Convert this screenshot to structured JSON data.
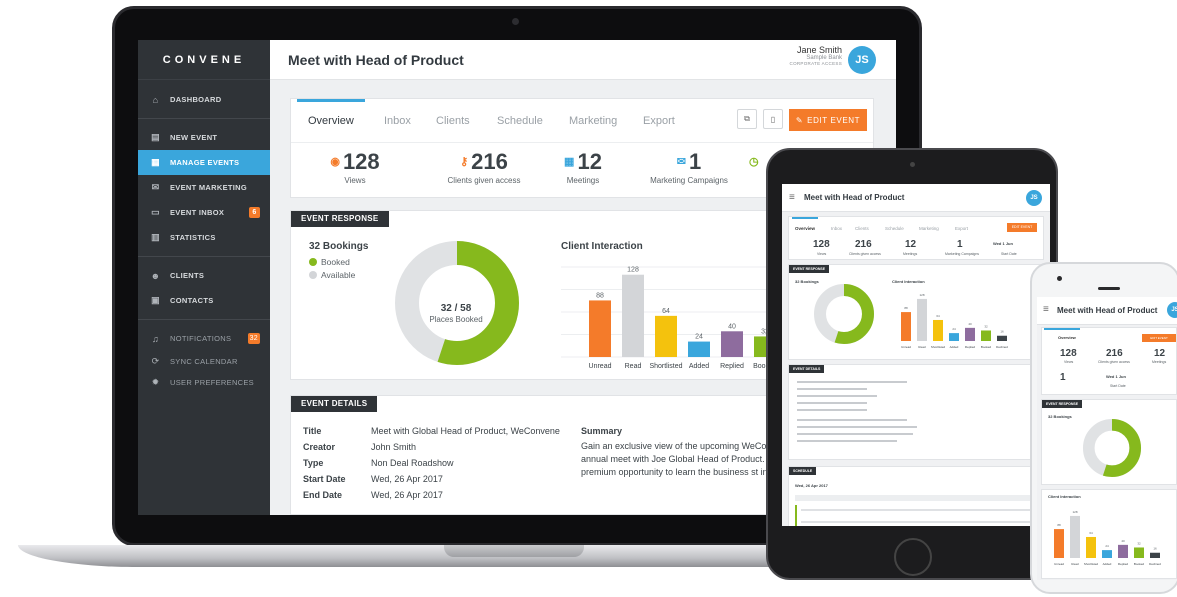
{
  "app": {
    "logo": "CONVENE",
    "page_title": "Meet with Head of Product",
    "user": {
      "name": "Jane Smith",
      "org": "Sample Bank",
      "role": "CORPORATE ACCESS",
      "initials": "JS"
    }
  },
  "sidebar": {
    "items": [
      {
        "label": "DASHBOARD",
        "icon": "home-icon"
      },
      {
        "label": "NEW EVENT",
        "icon": "document-icon"
      },
      {
        "label": "MANAGE EVENTS",
        "icon": "calendar-icon",
        "active": true
      },
      {
        "label": "EVENT MARKETING",
        "icon": "envelope-icon"
      },
      {
        "label": "EVENT INBOX",
        "icon": "inbox-icon",
        "badge": "6"
      },
      {
        "label": "STATISTICS",
        "icon": "bar-chart-icon"
      },
      {
        "label": "CLIENTS",
        "icon": "users-icon"
      },
      {
        "label": "CONTACTS",
        "icon": "contact-card-icon"
      },
      {
        "label": "NOTIFICATIONS",
        "icon": "bell-icon",
        "badge": "32"
      },
      {
        "label": "SYNC CALENDAR",
        "icon": "sync-icon"
      },
      {
        "label": "USER PREFERENCES",
        "icon": "gear-icon"
      }
    ]
  },
  "tabs": [
    "Overview",
    "Inbox",
    "Clients",
    "Schedule",
    "Marketing",
    "Export"
  ],
  "toolbar": {
    "edit_label": "EDIT EVENT"
  },
  "stats": [
    {
      "value": "128",
      "label": "Views",
      "icon": "eye-icon",
      "color": "#f47b2a"
    },
    {
      "value": "216",
      "label": "Clients given access",
      "icon": "key-icon",
      "color": "#f47b2a"
    },
    {
      "value": "12",
      "label": "Meetings",
      "icon": "calendar-icon",
      "color": "#3aa6dc"
    },
    {
      "value": "1",
      "label": "Marketing Campaigns",
      "icon": "envelope-icon",
      "color": "#3aa6dc"
    }
  ],
  "event_response": {
    "tag": "EVENT RESPONSE",
    "bookings_title": "32 Bookings",
    "legend": [
      {
        "label": "Booked",
        "color": "#86b91d"
      },
      {
        "label": "Available",
        "color": "#d3d5d8"
      }
    ],
    "donut_main": "32 / 58",
    "donut_sub": "Places Booked",
    "booked_fraction": 0.55,
    "chart_title": "Client Interaction"
  },
  "chart_data": {
    "type": "bar",
    "title": "Client Interaction",
    "categories": [
      "Unread",
      "Read",
      "Shortlisted",
      "Added",
      "Replied",
      "Booked",
      "Declined"
    ],
    "values": [
      88,
      128,
      64,
      24,
      40,
      32,
      16
    ],
    "colors": [
      "#f47b2a",
      "#d3d5d8",
      "#f4c20d",
      "#3aa6dc",
      "#8e6c9e",
      "#86b91d",
      "#3c4348"
    ],
    "ylim": [
      0,
      140
    ],
    "grid": true
  },
  "event_details": {
    "tag": "EVENT DETAILS",
    "rows": [
      {
        "label": "Title",
        "value": "Meet with Global Head of Product, WeConvene"
      },
      {
        "label": "Creator",
        "value": "John Smith"
      },
      {
        "label": "Type",
        "value": "Non Deal Roadshow"
      },
      {
        "label": "Start Date",
        "value": "Wed, 26 Apr 2017"
      },
      {
        "label": "End Date",
        "value": "Wed, 26 Apr 2017"
      }
    ],
    "summary_title": "Summary",
    "summary_text": "Gain an exclusive view of the upcoming WeCo roadmap by joining our annual meet with Joe Global Head of Product. Accompanying with C premium opportunity to learn the business st insights."
  },
  "mobile": {
    "start_date_value": "Wed 1 Jun",
    "start_date_label": "Start Date",
    "schedule_tag": "SCHEDULE",
    "schedule_date": "Wed, 26 Apr 2017"
  }
}
